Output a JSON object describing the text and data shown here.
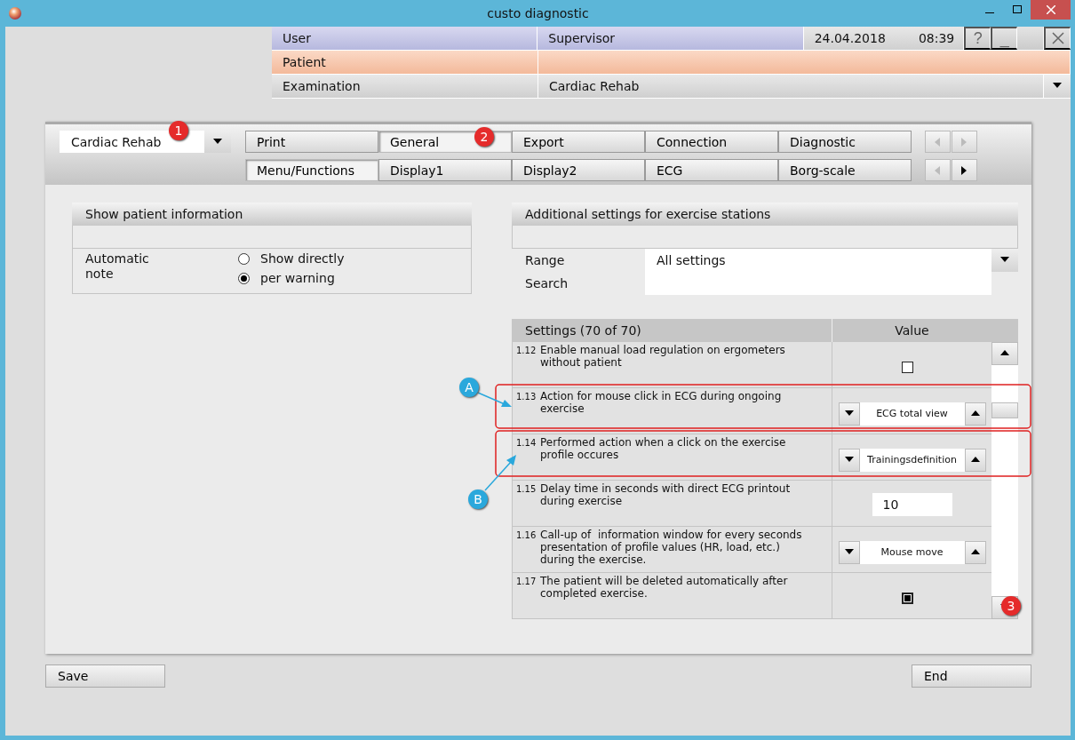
{
  "window": {
    "title": "custo diagnostic"
  },
  "header": {
    "user_label": "User",
    "user_value": "Supervisor",
    "date": "24.04.2018",
    "time": "08:39",
    "help": "?",
    "minimize": "_",
    "patient_label": "Patient",
    "examination_label": "Examination",
    "examination_value": "Cardiac Rehab"
  },
  "profile": {
    "value": "Cardiac Rehab"
  },
  "tab_rows": [
    {
      "tabs": [
        {
          "label": "Print",
          "selected": false
        },
        {
          "label": "General",
          "selected": true
        },
        {
          "label": "Export",
          "selected": false
        },
        {
          "label": "Connection",
          "selected": false
        },
        {
          "label": "Diagnostic",
          "selected": false
        }
      ],
      "prev_disabled": true,
      "next_disabled": true
    },
    {
      "tabs": [
        {
          "label": "Menu/Functions",
          "selected": true
        },
        {
          "label": "Display1",
          "selected": false
        },
        {
          "label": "Display2",
          "selected": false
        },
        {
          "label": "ECG",
          "selected": false
        },
        {
          "label": "Borg-scale",
          "selected": false
        }
      ],
      "prev_disabled": true,
      "next_disabled": false
    }
  ],
  "patient_info": {
    "title": "Show patient information",
    "label": "Automatic note",
    "options": [
      {
        "label": "Show directly",
        "selected": false
      },
      {
        "label": "per warning",
        "selected": true
      }
    ]
  },
  "exercise": {
    "title": "Additional settings for exercise stations",
    "range_label": "Range",
    "range_value": "All settings",
    "search_label": "Search",
    "columns": [
      "Settings (70 of 70)",
      "Value"
    ],
    "rows": [
      {
        "number": "1.12",
        "text": "Enable manual load regulation on ergometers without patient",
        "kind": "checkbox",
        "checked": false
      },
      {
        "number": "1.13",
        "text": "Action for mouse click in ECG during ongoing exercise",
        "kind": "spinner",
        "value": "ECG total view"
      },
      {
        "number": "1.14",
        "text": "Performed action when a click on the exercise profile occures",
        "kind": "spinner",
        "value": "Trainingsdefinition"
      },
      {
        "number": "1.15",
        "text": "Delay time in seconds with direct ECG printout during exercise",
        "kind": "number",
        "value": "10"
      },
      {
        "number": "1.16",
        "text": "Call-up of  information window for every seconds presentation of profile values (HR, load, etc.) during the exercise.",
        "kind": "spinner",
        "value": "Mouse move"
      },
      {
        "number": "1.17",
        "text": "The patient will be deleted automatically after completed exercise.",
        "kind": "checkbox",
        "checked": true
      }
    ]
  },
  "annotations": [
    {
      "label": "1",
      "color": "#e52b2b"
    },
    {
      "label": "2",
      "color": "#e52b2b"
    },
    {
      "label": "3",
      "color": "#e52b2b"
    },
    {
      "label": "A",
      "color": "#2aa8dc"
    },
    {
      "label": "B",
      "color": "#2aa8dc"
    }
  ],
  "buttons": {
    "save": "Save",
    "end": "End"
  }
}
